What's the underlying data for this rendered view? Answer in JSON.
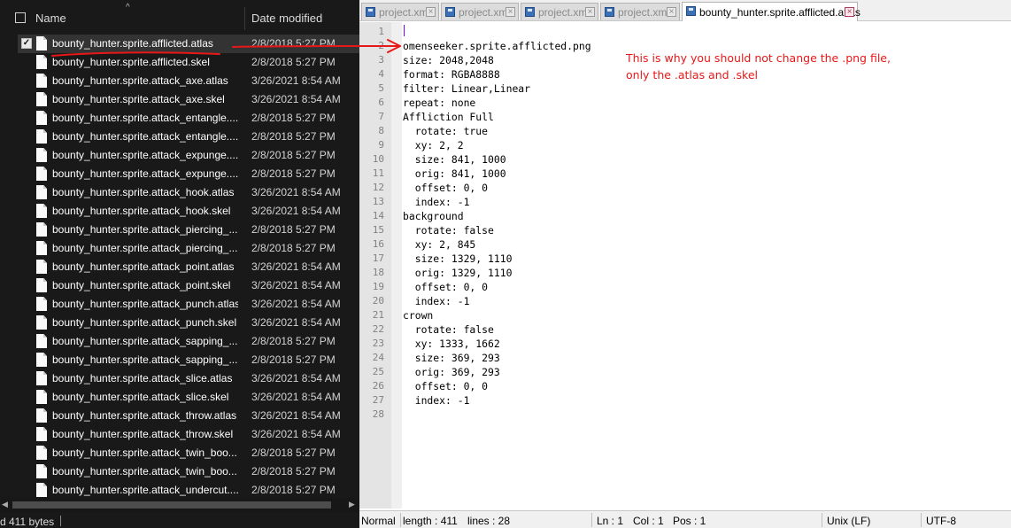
{
  "explorer": {
    "header": {
      "name": "Name",
      "date": "Date modified"
    },
    "files": [
      {
        "name": "bounty_hunter.sprite.afflicted.atlas",
        "date": "2/8/2018 5:27 PM",
        "selected": true
      },
      {
        "name": "bounty_hunter.sprite.afflicted.skel",
        "date": "2/8/2018 5:27 PM"
      },
      {
        "name": "bounty_hunter.sprite.attack_axe.atlas",
        "date": "3/26/2021 8:54 AM"
      },
      {
        "name": "bounty_hunter.sprite.attack_axe.skel",
        "date": "3/26/2021 8:54 AM"
      },
      {
        "name": "bounty_hunter.sprite.attack_entangle....",
        "date": "2/8/2018 5:27 PM"
      },
      {
        "name": "bounty_hunter.sprite.attack_entangle....",
        "date": "2/8/2018 5:27 PM"
      },
      {
        "name": "bounty_hunter.sprite.attack_expunge....",
        "date": "2/8/2018 5:27 PM"
      },
      {
        "name": "bounty_hunter.sprite.attack_expunge....",
        "date": "2/8/2018 5:27 PM"
      },
      {
        "name": "bounty_hunter.sprite.attack_hook.atlas",
        "date": "3/26/2021 8:54 AM"
      },
      {
        "name": "bounty_hunter.sprite.attack_hook.skel",
        "date": "3/26/2021 8:54 AM"
      },
      {
        "name": "bounty_hunter.sprite.attack_piercing_...",
        "date": "2/8/2018 5:27 PM"
      },
      {
        "name": "bounty_hunter.sprite.attack_piercing_...",
        "date": "2/8/2018 5:27 PM"
      },
      {
        "name": "bounty_hunter.sprite.attack_point.atlas",
        "date": "3/26/2021 8:54 AM"
      },
      {
        "name": "bounty_hunter.sprite.attack_point.skel",
        "date": "3/26/2021 8:54 AM"
      },
      {
        "name": "bounty_hunter.sprite.attack_punch.atlas",
        "date": "3/26/2021 8:54 AM"
      },
      {
        "name": "bounty_hunter.sprite.attack_punch.skel",
        "date": "3/26/2021 8:54 AM"
      },
      {
        "name": "bounty_hunter.sprite.attack_sapping_...",
        "date": "2/8/2018 5:27 PM"
      },
      {
        "name": "bounty_hunter.sprite.attack_sapping_...",
        "date": "2/8/2018 5:27 PM"
      },
      {
        "name": "bounty_hunter.sprite.attack_slice.atlas",
        "date": "3/26/2021 8:54 AM"
      },
      {
        "name": "bounty_hunter.sprite.attack_slice.skel",
        "date": "3/26/2021 8:54 AM"
      },
      {
        "name": "bounty_hunter.sprite.attack_throw.atlas",
        "date": "3/26/2021 8:54 AM"
      },
      {
        "name": "bounty_hunter.sprite.attack_throw.skel",
        "date": "3/26/2021 8:54 AM"
      },
      {
        "name": "bounty_hunter.sprite.attack_twin_boo...",
        "date": "2/8/2018 5:27 PM"
      },
      {
        "name": "bounty_hunter.sprite.attack_twin_boo...",
        "date": "2/8/2018 5:27 PM"
      },
      {
        "name": "bounty_hunter.sprite.attack_undercut....",
        "date": "2/8/2018 5:27 PM"
      }
    ],
    "status": {
      "text": "d  411 bytes"
    }
  },
  "editor": {
    "tabs": [
      {
        "label": "project.xml",
        "active": false
      },
      {
        "label": "project.xml",
        "active": false
      },
      {
        "label": "project.xml",
        "active": false
      },
      {
        "label": "project.xml",
        "active": false
      },
      {
        "label": "bounty_hunter.sprite.afflicted.atlas",
        "active": true
      }
    ],
    "lines": [
      "",
      "omenseeker.sprite.afflicted.png",
      "size: 2048,2048",
      "format: RGBA8888",
      "filter: Linear,Linear",
      "repeat: none",
      "Affliction Full",
      "  rotate: true",
      "  xy: 2, 2",
      "  size: 841, 1000",
      "  orig: 841, 1000",
      "  offset: 0, 0",
      "  index: -1",
      "background",
      "  rotate: false",
      "  xy: 2, 845",
      "  size: 1329, 1110",
      "  orig: 1329, 1110",
      "  offset: 0, 0",
      "  index: -1",
      "crown",
      "  rotate: false",
      "  xy: 1333, 1662",
      "  size: 369, 293",
      "  orig: 369, 293",
      "  offset: 0, 0",
      "  index: -1",
      ""
    ],
    "annotation": "This is why you should not change the .png file, only the .atlas and .skel",
    "status": {
      "mode": "Normal",
      "length": "length : 411",
      "lines": "lines : 28",
      "ln": "Ln : 1",
      "col": "Col : 1",
      "pos": "Pos : 1",
      "eol": "Unix (LF)",
      "encoding": "UTF-8"
    }
  },
  "colors": {
    "annotation": "#e81818",
    "explorer_bg": "#191919",
    "selected_row": "#333333",
    "caret": "#8000ff"
  }
}
